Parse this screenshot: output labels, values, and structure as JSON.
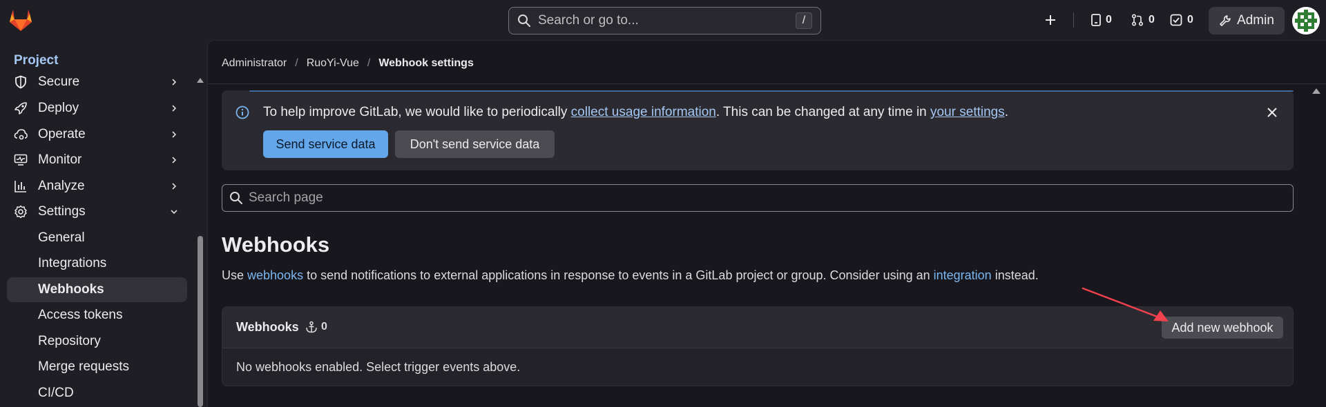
{
  "header": {
    "search_placeholder": "Search or go to...",
    "search_shortcut": "/",
    "counters": [
      {
        "name": "issues",
        "count": "0"
      },
      {
        "name": "merge-requests",
        "count": "0"
      },
      {
        "name": "todos",
        "count": "0"
      }
    ],
    "admin_label": "Admin"
  },
  "sidebar": {
    "title": "Project",
    "items": [
      {
        "label": "Secure"
      },
      {
        "label": "Deploy"
      },
      {
        "label": "Operate"
      },
      {
        "label": "Monitor"
      },
      {
        "label": "Analyze"
      },
      {
        "label": "Settings"
      }
    ],
    "sub_items": [
      {
        "label": "General"
      },
      {
        "label": "Integrations"
      },
      {
        "label": "Webhooks"
      },
      {
        "label": "Access tokens"
      },
      {
        "label": "Repository"
      },
      {
        "label": "Merge requests"
      },
      {
        "label": "CI/CD"
      }
    ]
  },
  "breadcrumb": {
    "items": [
      "Administrator",
      "RuoYi-Vue",
      "Webhook settings"
    ],
    "separator": "/"
  },
  "alert": {
    "text_before": "To help improve GitLab, we would like to periodically ",
    "link1": "collect usage information",
    "text_middle": ". This can be changed at any time in ",
    "link2": "your settings",
    "text_after": ".",
    "primary_button": "Send service data",
    "secondary_button": "Don't send service data"
  },
  "page_search": {
    "placeholder": "Search page"
  },
  "main": {
    "title": "Webhooks",
    "desc_before": "Use ",
    "desc_link1": "webhooks",
    "desc_middle": " to send notifications to external applications in response to events in a GitLab project or group. Consider using an ",
    "desc_link2": "integration",
    "desc_after": " instead."
  },
  "card": {
    "title": "Webhooks",
    "count": "0",
    "add_button": "Add new webhook",
    "empty_text": "No webhooks enabled. Select trigger events above."
  },
  "colors": {
    "accent": "#63a6e9",
    "link": "#a4c7f3",
    "annotation_arrow": "#f0414e"
  }
}
